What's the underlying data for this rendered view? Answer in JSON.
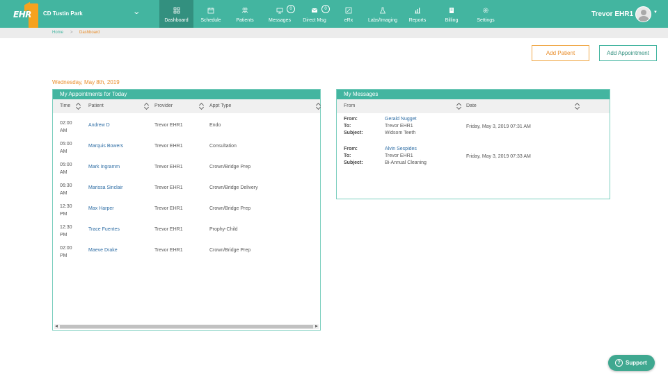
{
  "brand": {
    "logo_text": "EHR",
    "clinic": "CD Tustin Park"
  },
  "nav": [
    {
      "key": "dashboard",
      "label": "Dashboard",
      "icon": "dashboard-icon",
      "active": true
    },
    {
      "key": "schedule",
      "label": "Schedule",
      "icon": "calendar-icon"
    },
    {
      "key": "patients",
      "label": "Patients",
      "icon": "patients-icon"
    },
    {
      "key": "messages",
      "label": "Messages",
      "icon": "monitor-icon",
      "badge": "0"
    },
    {
      "key": "direct_msg",
      "label": "Direct Msg",
      "icon": "envelope-icon",
      "badge": "0"
    },
    {
      "key": "erx",
      "label": "eRx",
      "icon": "edit-icon"
    },
    {
      "key": "labs",
      "label": "Labs/Imaging",
      "icon": "flask-icon"
    },
    {
      "key": "reports",
      "label": "Reports",
      "icon": "bar-chart-icon"
    },
    {
      "key": "billing",
      "label": "Billing",
      "icon": "billing-icon"
    },
    {
      "key": "settings",
      "label": "Settings",
      "icon": "gear-icon"
    }
  ],
  "user": {
    "name": "Trevor EHR1"
  },
  "breadcrumb": {
    "home": "Home",
    "separator": ">",
    "current": "Dashboard"
  },
  "actions": {
    "add_patient": "Add Patient",
    "add_appointment": "Add Appointment"
  },
  "date": "Wednesday, May 8th, 2019",
  "appointments": {
    "title": "My Appointments for Today",
    "columns": {
      "time": "Time",
      "patient": "Patient",
      "provider": "Provider",
      "type": "Appt Type"
    },
    "rows": [
      {
        "time_hm": "02:00",
        "time_ampm": "AM",
        "patient": "Andrew D",
        "provider": "Trevor EHR1",
        "type": "Endo"
      },
      {
        "time_hm": "05:00",
        "time_ampm": "AM",
        "patient": "Marquis Bowers",
        "provider": "Trevor EHR1",
        "type": "Consultation"
      },
      {
        "time_hm": "05:00",
        "time_ampm": "AM",
        "patient": "Mark Ingramm",
        "provider": "Trevor EHR1",
        "type": "Crown/Bridge Prep"
      },
      {
        "time_hm": "06:30",
        "time_ampm": "AM",
        "patient": "Marissa Sinclair",
        "provider": "Trevor EHR1",
        "type": "Crown/Bridge Delivery"
      },
      {
        "time_hm": "12:30",
        "time_ampm": "PM",
        "patient": "Max Harper",
        "provider": "Trevor EHR1",
        "type": "Crown/Bridge Prep"
      },
      {
        "time_hm": "12:30",
        "time_ampm": "PM",
        "patient": "Trace Fuentes",
        "provider": "Trevor EHR1",
        "type": "Prophy-Child"
      },
      {
        "time_hm": "02:00",
        "time_ampm": "PM",
        "patient": "Maeve Drake",
        "provider": "Trevor EHR1",
        "type": "Crown/Bridge Prep"
      }
    ]
  },
  "messages": {
    "title": "My Messages",
    "columns": {
      "from": "From",
      "date": "Date"
    },
    "labels": {
      "from": "From:",
      "to": "To:",
      "subject": "Subject:"
    },
    "rows": [
      {
        "from": "Gerald Nugget",
        "to": "Trevor EHR1",
        "subject": "Widsom Teeth",
        "date": "Friday, May 3, 2019 07:31 AM"
      },
      {
        "from": "Alvin Sespides",
        "to": "Trevor EHR1",
        "subject": "Bi-Annual Cleaning",
        "date": "Friday, May 3, 2019 07:33 AM"
      }
    ]
  },
  "support": {
    "icon_glyph": "?",
    "label": "Support"
  },
  "colors": {
    "primary": "#43b5a0",
    "primary_dark": "#33907f",
    "accent": "#e98d2a",
    "link": "#2f6ea5"
  }
}
